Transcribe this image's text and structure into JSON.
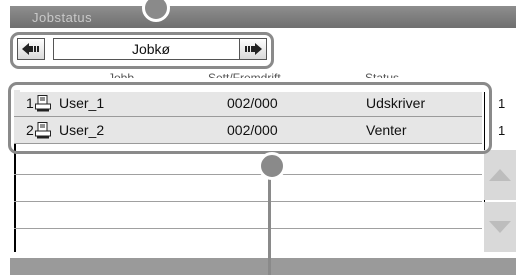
{
  "window": {
    "title": "Jobstatus"
  },
  "nav": {
    "label": "Jobkø",
    "prev_icon": "arrow-left-icon",
    "next_icon": "arrow-right-icon"
  },
  "columns": {
    "job": "Jobb",
    "set": "Sett/Fremdrift",
    "status": "Status"
  },
  "jobs": [
    {
      "index": "1",
      "icon": "printer-job-icon",
      "name": "User_1",
      "progress": "002/000",
      "status": "Udskriver"
    },
    {
      "index": "2",
      "icon": "printer-job-icon",
      "name": "User_2",
      "progress": "002/000",
      "status": "Venter"
    }
  ],
  "right_column": {
    "row_numbers": [
      "1",
      "1"
    ]
  },
  "colors": {
    "callout": "#8a8a8a",
    "title_bar": "#7a7a7a",
    "row_bg": "#e6e6e6"
  }
}
